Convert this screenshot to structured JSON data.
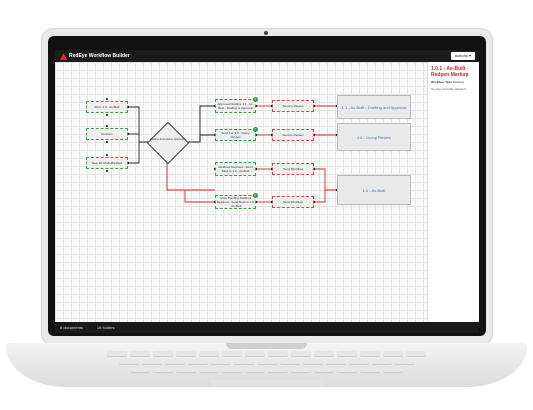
{
  "app": {
    "title": "RedEye Workflow Builder",
    "actions_label": "Actions ▾"
  },
  "panel": {
    "title": "1.0.1 - As-Built - Redpen Markup",
    "type_label": "Workflow Type",
    "type_value": "Drawing",
    "note": "No step currently selected"
  },
  "status": {
    "documents": "8 documents",
    "folders": "16 folders"
  },
  "nodes": {
    "n1": "From 1.0 - As-Built",
    "n2": "Revision",
    "n3": "New 3D Model/Drafted",
    "decision": "Redline Submission Approval",
    "a1": "Approved Redline 1.1 - As-Built - Drafting & Approval",
    "a2": "Send to Review",
    "b1": "Send For 4.0 - Group Review",
    "b2": "Send to Review",
    "c1": "Redlined Declined - Send Back to 1.0 - As-Built",
    "c2": "Send Workflow",
    "d1": "Issue Pending Redlines Declined - Send Back to 1.0 - As-Built",
    "d2": "Send Workflow"
  },
  "stages": {
    "s1": "1.1 - As-Built - Drafting and Approval",
    "s2": "4.0 - Group Review",
    "s3": "1.0 - As-Built"
  },
  "colors": {
    "accent": "#c0282d",
    "link_blue": "#3a78c2",
    "approved_green": "#2e9c4a"
  }
}
